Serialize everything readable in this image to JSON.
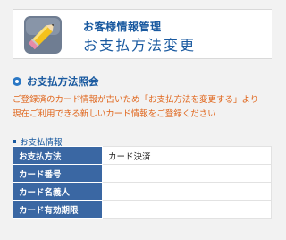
{
  "header": {
    "icon": "pencil-icon",
    "subtitle": "お客様情報管理",
    "title": "お支払方法変更"
  },
  "section": {
    "heading": "お支払方法照会",
    "notice_line1": "ご登録済のカード情報が古いため「お支払方法を変更する」より",
    "notice_line2": "現在ご利用できる新しいカード情報をご登録ください"
  },
  "payment_info": {
    "heading": "お支払情報",
    "rows": [
      {
        "label": "お支払方法",
        "value": "カード決済"
      },
      {
        "label": "カード番号",
        "value": ""
      },
      {
        "label": "カード名義人",
        "value": ""
      },
      {
        "label": "カード有効期限",
        "value": ""
      }
    ]
  },
  "colors": {
    "accent": "#1a5aa0",
    "table_header": "#3a67a3",
    "notice": "#e0661c"
  }
}
